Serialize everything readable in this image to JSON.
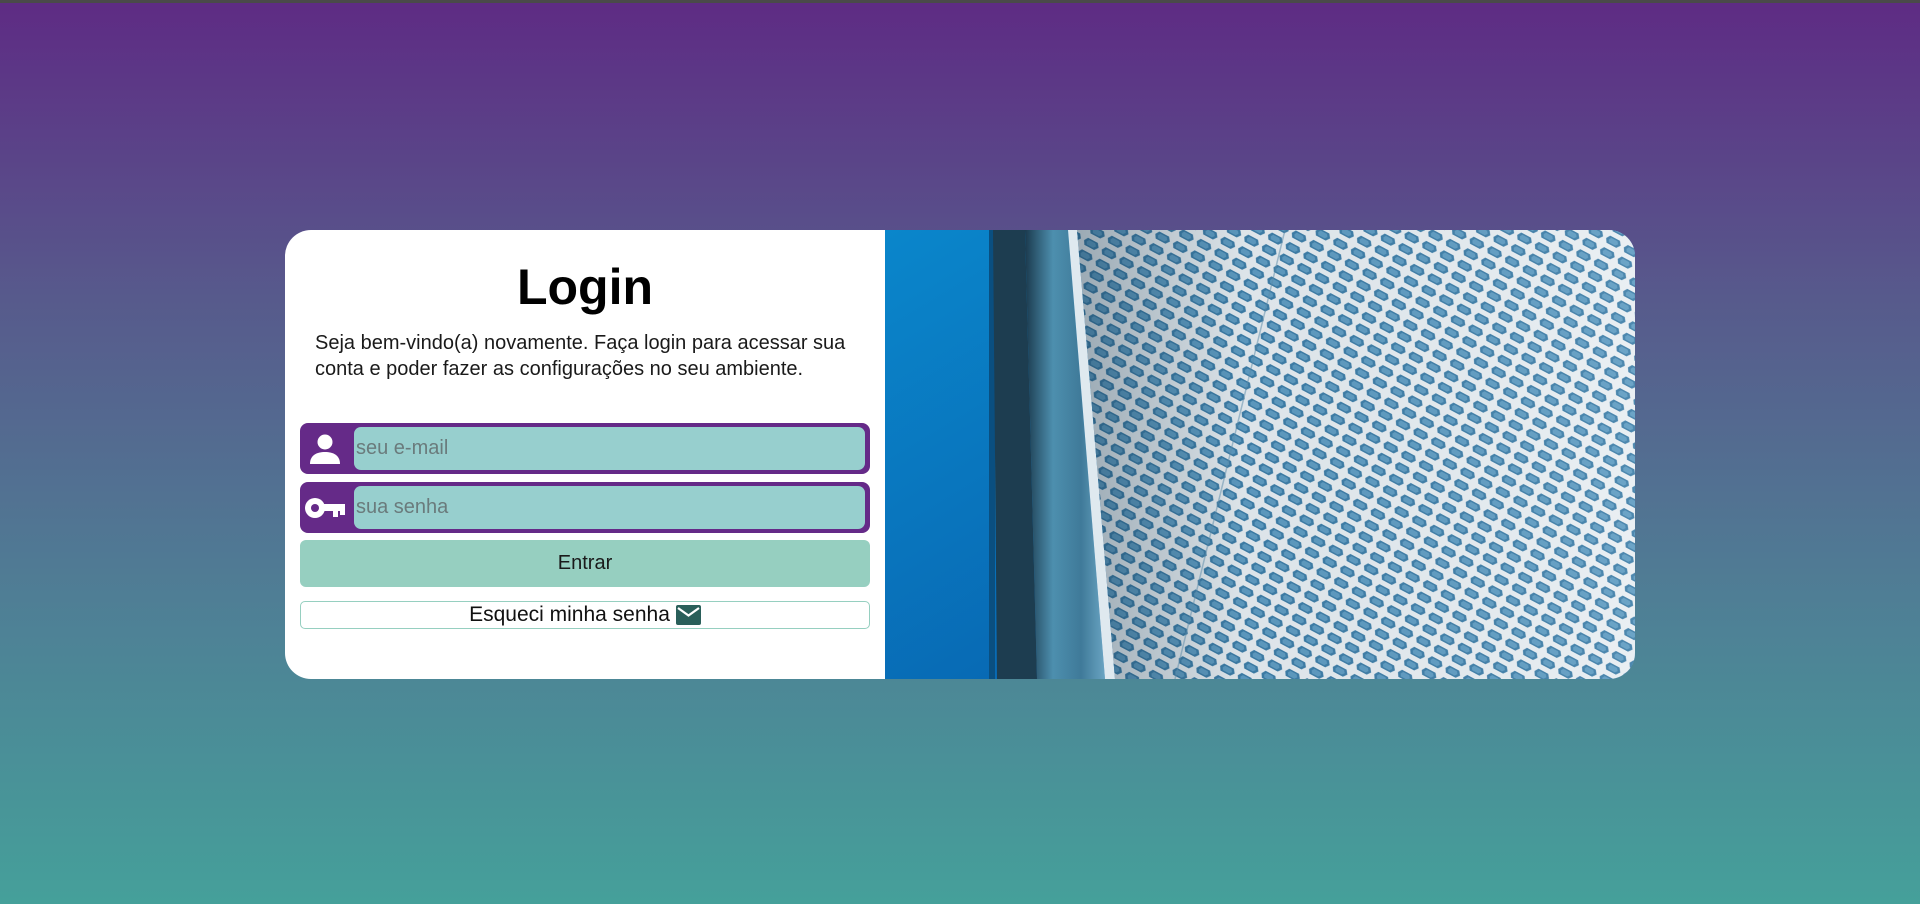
{
  "login": {
    "title": "Login",
    "description": "Seja bem-vindo(a) novamente. Faça login para acessar sua conta e poder fazer as configurações no seu ambiente.",
    "email_placeholder": "seu e-mail",
    "email_value": "",
    "password_placeholder": "sua senha",
    "password_value": "",
    "submit_label": "Entrar",
    "forgot_label": "Esqueci minha senha"
  },
  "icons": {
    "email_field": "user-icon",
    "password_field": "key-icon",
    "forgot": "envelope-icon"
  },
  "colors": {
    "field_border": "#652a88",
    "input_bg": "#97cfce",
    "submit_bg": "#96cfc0",
    "forgot_border": "#96cfc0",
    "gradient_top": "#5e2b84",
    "gradient_bottom": "#45a09a"
  }
}
